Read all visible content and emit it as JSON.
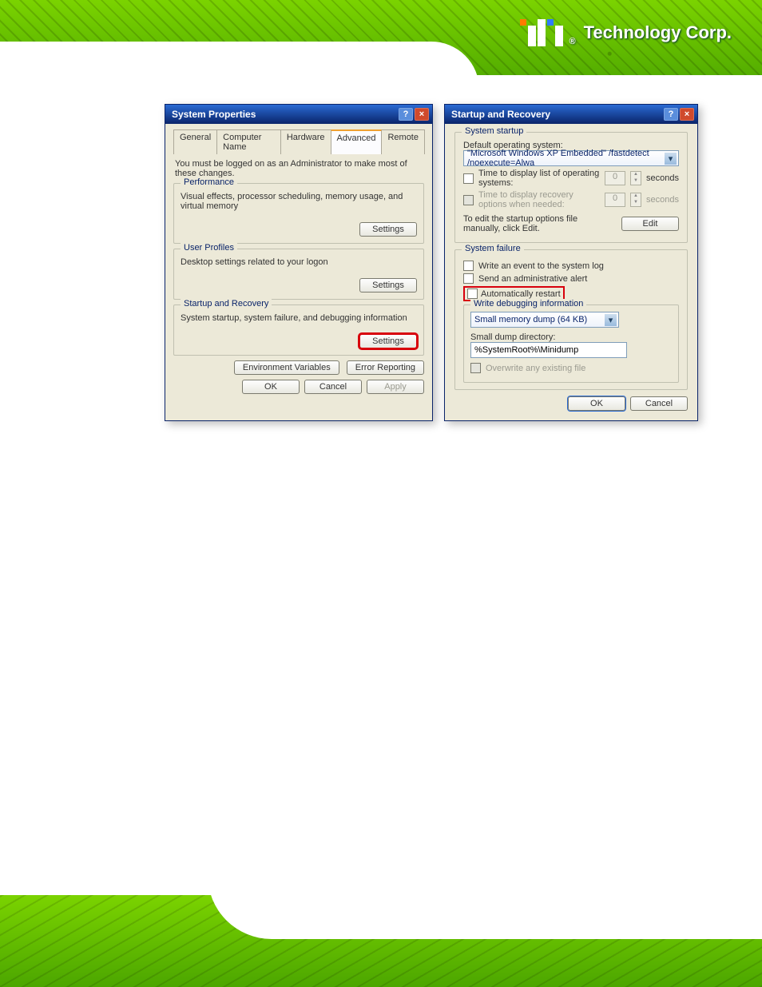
{
  "brand": {
    "name": "Technology Corp.",
    "registered": "®"
  },
  "sysprop": {
    "title": "System Properties",
    "tabs": {
      "general": "General",
      "computer_name": "Computer Name",
      "hardware": "Hardware",
      "advanced": "Advanced",
      "remote": "Remote"
    },
    "note": "You must be logged on as an Administrator to make most of these changes.",
    "performance": {
      "title": "Performance",
      "desc": "Visual effects, processor scheduling, memory usage, and virtual memory",
      "settings_btn": "Settings"
    },
    "user_profiles": {
      "title": "User Profiles",
      "desc": "Desktop settings related to your logon",
      "settings_btn": "Settings"
    },
    "startup_recovery": {
      "title": "Startup and Recovery",
      "desc": "System startup, system failure, and debugging information",
      "settings_btn": "Settings"
    },
    "env_vars_btn": "Environment Variables",
    "error_report_btn": "Error Reporting",
    "ok": "OK",
    "cancel": "Cancel",
    "apply": "Apply"
  },
  "startup": {
    "title": "Startup and Recovery",
    "system_startup": {
      "title": "System startup",
      "default_os_label": "Default operating system:",
      "default_os_value": "\"Microsoft Windows XP Embedded\" /fastdetect /noexecute=Alwa",
      "display_list_label": "Time to display list of operating systems:",
      "display_list_value": "0",
      "display_list_unit": "seconds",
      "display_recovery_label": "Time to display recovery options when needed:",
      "display_recovery_value": "0",
      "display_recovery_unit": "seconds",
      "edit_hint": "To edit the startup options file manually, click Edit.",
      "edit_btn": "Edit"
    },
    "system_failure": {
      "title": "System failure",
      "write_event": "Write an event to the system log",
      "send_alert": "Send an administrative alert",
      "auto_restart": "Automatically restart",
      "debug_title": "Write debugging information",
      "dump_type": "Small memory dump (64 KB)",
      "dump_dir_label": "Small dump directory:",
      "dump_dir_value": "%SystemRoot%\\Minidump",
      "overwrite": "Overwrite any existing file"
    },
    "ok": "OK",
    "cancel": "Cancel"
  }
}
